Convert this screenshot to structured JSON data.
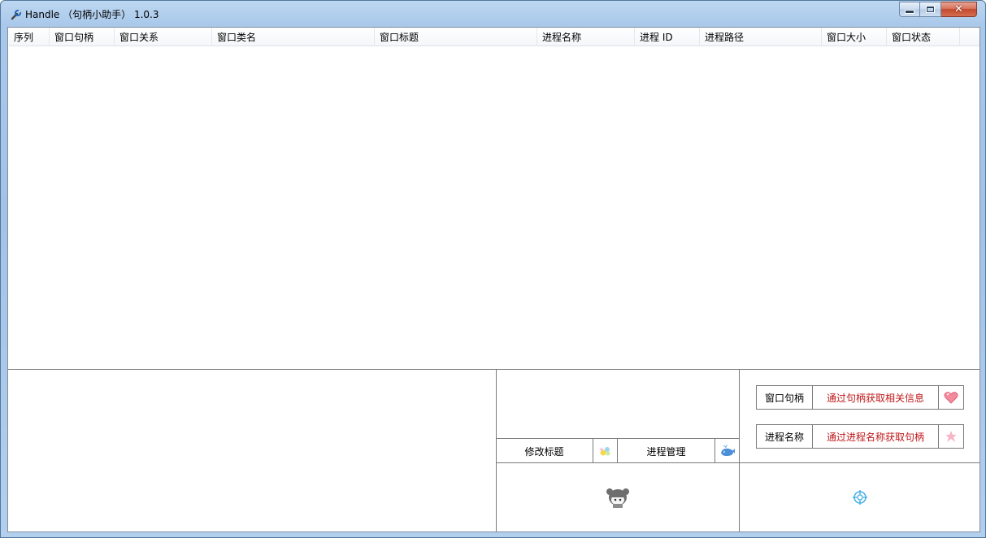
{
  "window": {
    "title": "Handle （句柄小助手） 1.0.3",
    "icons": {
      "app": "wrench-icon",
      "minimize": "minimize-icon",
      "maximize": "maximize-icon",
      "close": "close-icon"
    }
  },
  "list": {
    "columns": [
      "序列",
      "窗口句柄",
      "窗口关系",
      "窗口类名",
      "窗口标题",
      "进程名称",
      "进程 ID",
      "进程路径",
      "窗口大小",
      "窗口状态"
    ],
    "rows": []
  },
  "actions": {
    "edit_title": "修改标题",
    "process_manage": "进程管理",
    "handle_label": "窗口句柄",
    "handle_action": "通过句柄获取相关信息",
    "process_name_label": "进程名称",
    "process_name_action": "通过进程名称获取句柄"
  },
  "icons": {
    "edit_title": "sparkle-icon",
    "process_manage": "whale-icon",
    "handle_action": "heart-icon",
    "process_name_action": "star-icon",
    "character": "anime-girl-icon",
    "target": "crosshair-target-icon"
  },
  "colors": {
    "action_text": "#c0181a",
    "border": "#7a7a7a"
  }
}
